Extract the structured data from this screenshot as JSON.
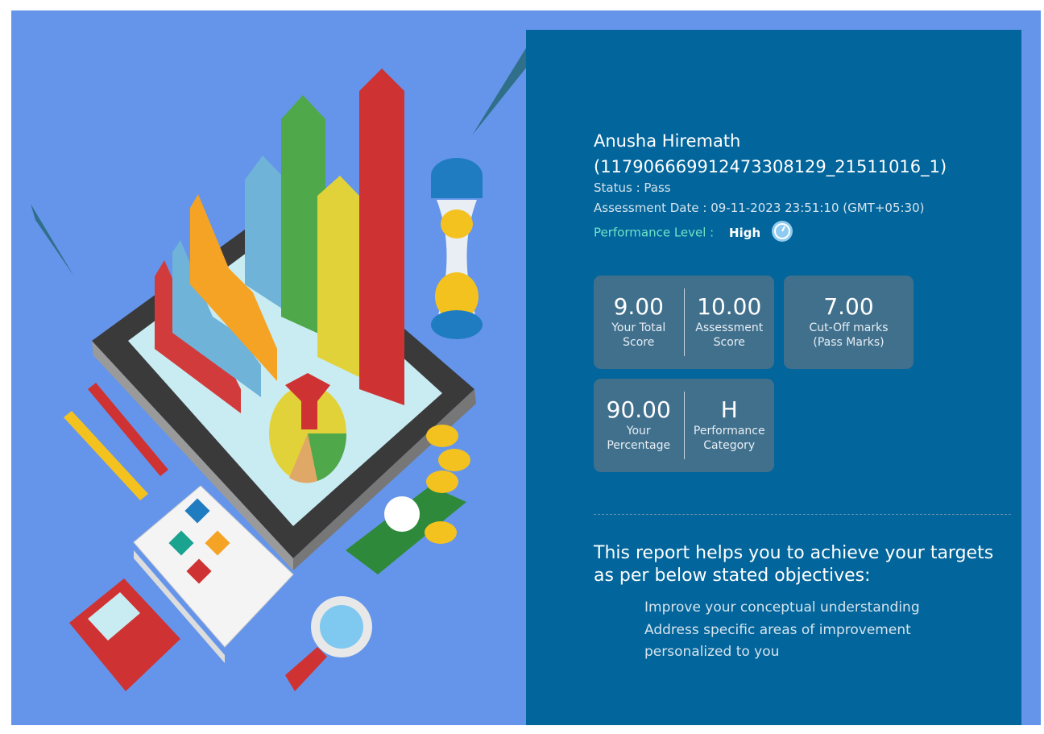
{
  "candidate": {
    "name": "Anusha Hiremath",
    "id": "(117906669912473308129_21511016_1)",
    "status": "Status : Pass",
    "assessment_date": "Assessment Date : 09-11-2023 23:51:10 (GMT+05:30)",
    "performance_label": "Performance Level :",
    "performance_value": "High",
    "performance_icon": "gauge-icon"
  },
  "scores": {
    "total_score": {
      "value": "9.00",
      "label1": "Your Total",
      "label2": "Score"
    },
    "assessment_score": {
      "value": "10.00",
      "label1": "Assessment",
      "label2": "Score"
    },
    "cutoff": {
      "value": "7.00",
      "label1": "Cut-Off marks",
      "label2": "(Pass Marks)"
    },
    "percentage": {
      "value": "90.00",
      "label1": "Your",
      "label2": "Percentage"
    },
    "category": {
      "value": "H",
      "label1": "Performance",
      "label2": "Category"
    }
  },
  "report": {
    "heading": "This report helps you to achieve your targets as per below stated objectives:",
    "objectives": [
      "Improve your conceptual understanding",
      "Address specific areas of improvement",
      "personalized to you"
    ]
  },
  "colors": {
    "background": "#6595ea",
    "panel": "#02659b",
    "card": "#41708d",
    "accent": "#6fe3c9"
  }
}
